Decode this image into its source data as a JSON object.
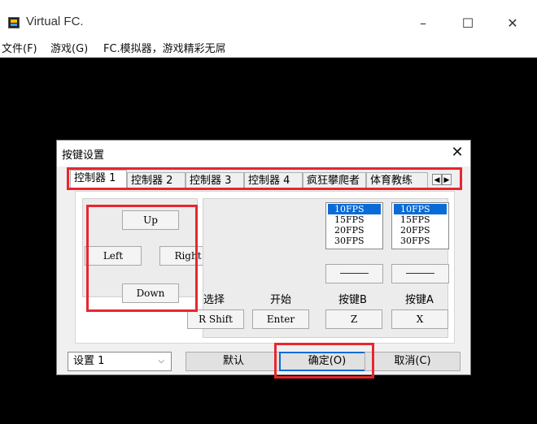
{
  "window": {
    "title": "Virtual FC.",
    "minimize": "–",
    "maximize": "☐",
    "close": "✕"
  },
  "menu": {
    "items": [
      "文件(F)",
      "游戏(G)",
      "FC.模拟器，游戏精彩无屌"
    ]
  },
  "dialog": {
    "title": "按键设置",
    "close": "✕",
    "tabs": [
      "控制器 1",
      "控制器 2",
      "控制器 3",
      "控制器 4",
      "疯狂攀爬者",
      "体育教练"
    ],
    "active_tab": 0,
    "tab_scroll_left": "◀",
    "tab_scroll_right": "▶",
    "dpad": {
      "up": "Up",
      "left": "Left",
      "right": "Right",
      "down": "Down"
    },
    "fps_b": {
      "options": [
        "10FPS",
        "15FPS",
        "20FPS",
        "30FPS"
      ],
      "selected": 0
    },
    "fps_a": {
      "options": [
        "10FPS",
        "15FPS",
        "20FPS",
        "30FPS"
      ],
      "selected": 0
    },
    "labels": {
      "select": "选择",
      "start": "开始",
      "button_b": "按键B",
      "button_a": "按键A"
    },
    "keys": {
      "select": "R Shift",
      "start": "Enter",
      "button_b": "Z",
      "button_a": "X"
    },
    "preset": {
      "value": "设置 1",
      "chevron": "⌵"
    },
    "buttons": {
      "default": "默认",
      "ok": "确定(O)",
      "cancel": "取消(C)"
    }
  },
  "colors": {
    "highlight_annotation": "#e8262f",
    "selection": "#0a6bd6",
    "screen": "#000000"
  }
}
